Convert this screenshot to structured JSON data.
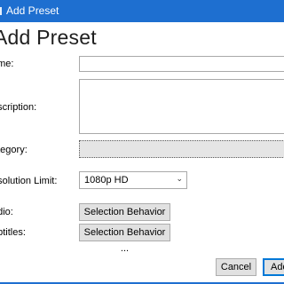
{
  "window": {
    "title": "Add Preset"
  },
  "page": {
    "heading": "Add Preset"
  },
  "form": {
    "name_label": "ame:",
    "name_value": "",
    "description_label": "escription:",
    "description_value": "",
    "category_label": "ategory:",
    "resolution_label": "esolution Limit:",
    "resolution_value": "1080p HD",
    "audio_label": "udio:",
    "audio_button": "Selection Behavior ...",
    "subtitles_label": "ubtitles:",
    "subtitles_button": "Selection Behavior ..."
  },
  "footer": {
    "cancel_label": "Cancel",
    "add_label": "Add"
  },
  "colors": {
    "accent": "#1e6fd0",
    "focus": "#0078d7"
  },
  "icons": {
    "dropdown": "chevron-down-icon",
    "window": "app-icon"
  }
}
